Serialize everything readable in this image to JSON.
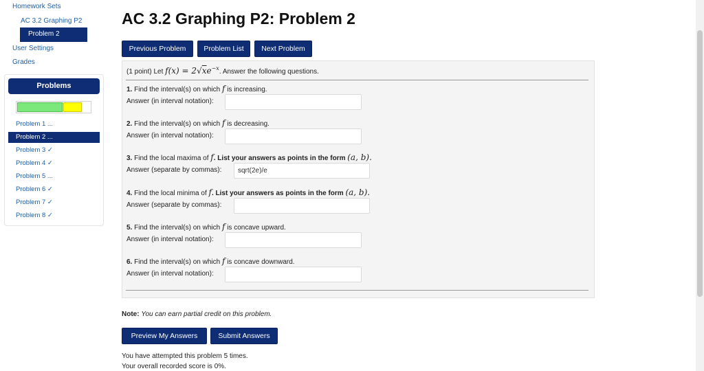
{
  "nav": {
    "homework_sets": "Homework Sets",
    "set_name": "AC 3.2 Graphing P2",
    "current_problem": "Problem 2",
    "user_settings": "User Settings",
    "grades": "Grades"
  },
  "sidebar": {
    "header": "Problems",
    "progress": {
      "correct_fraction": 0.625,
      "partial_fraction": 0.25,
      "correct_color": "#7ce87c",
      "partial_color": "#ffff00"
    },
    "items": [
      {
        "label": "Problem 1 ..."
      },
      {
        "label": "Problem 2 ..."
      },
      {
        "label": "Problem 3 ✓"
      },
      {
        "label": "Problem 4 ✓"
      },
      {
        "label": "Problem 5 ..."
      },
      {
        "label": "Problem 6 ✓"
      },
      {
        "label": "Problem 7 ✓"
      },
      {
        "label": "Problem 8 ✓"
      }
    ]
  },
  "page": {
    "title": "AC 3.2 Graphing P2: Problem 2",
    "nav_buttons": {
      "prev": "Previous Problem",
      "list": "Problem List",
      "next": "Next Problem"
    }
  },
  "problem": {
    "intro_prefix": "(1 point) Let",
    "intro_suffix": ". Answer the following questions.",
    "questions": [
      {
        "num": "1.",
        "pre": "Find the interval(s) on which",
        "f": "f",
        "post": "is increasing.",
        "answer_label": "Answer (in interval notation):",
        "value": ""
      },
      {
        "num": "2.",
        "pre": "Find the interval(s) on which",
        "f": "f",
        "post": "is decreasing.",
        "answer_label": "Answer (in interval notation):",
        "value": ""
      },
      {
        "num": "3.",
        "pre": "Find the local maxima of",
        "f": "f",
        "post": ". List your answers as points in the form",
        "form": "(a, b).",
        "answer_label": "Answer (separate by commas):",
        "value": "sqrt(2e)/e"
      },
      {
        "num": "4.",
        "pre": "Find the local minima of",
        "f": "f",
        "post": ". List your answers as points in the form",
        "form": "(a, b).",
        "answer_label": "Answer (separate by commas):",
        "value": ""
      },
      {
        "num": "5.",
        "pre": "Find the interval(s) on which",
        "f": "f",
        "post": "is concave upward.",
        "answer_label": "Answer (in interval notation):",
        "value": ""
      },
      {
        "num": "6.",
        "pre": "Find the interval(s) on which",
        "f": "f",
        "post": "is concave downward.",
        "answer_label": "Answer (in interval notation):",
        "value": ""
      }
    ]
  },
  "note": {
    "label": "Note:",
    "text": "You can earn partial credit on this problem."
  },
  "actions": {
    "preview": "Preview My Answers",
    "submit": "Submit Answers"
  },
  "status": {
    "attempts": "You have attempted this problem 5 times.",
    "score": "Your overall recorded score is 0%."
  }
}
